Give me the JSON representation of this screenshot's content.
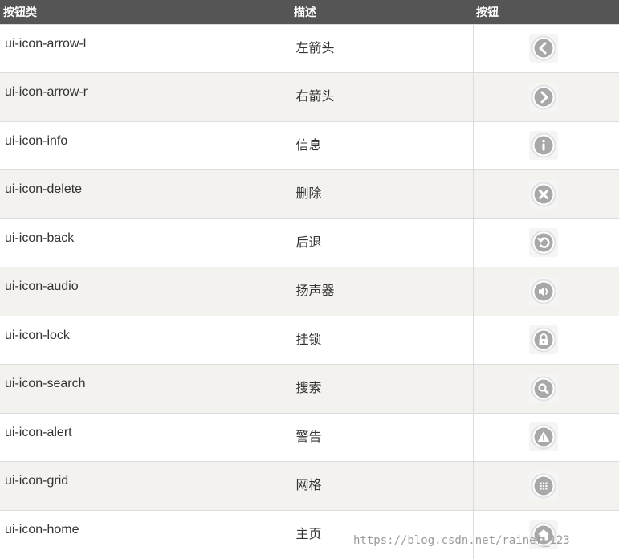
{
  "table": {
    "headers": [
      "按钮类",
      "描述",
      "按钮"
    ],
    "rows": [
      {
        "class_name": "ui-icon-arrow-l",
        "description": "左箭头",
        "icon": "arrow-left-icon"
      },
      {
        "class_name": "ui-icon-arrow-r",
        "description": "右箭头",
        "icon": "arrow-right-icon"
      },
      {
        "class_name": "ui-icon-info",
        "description": "信息",
        "icon": "info-icon"
      },
      {
        "class_name": "ui-icon-delete",
        "description": "删除",
        "icon": "delete-icon"
      },
      {
        "class_name": "ui-icon-back",
        "description": "后退",
        "icon": "back-icon"
      },
      {
        "class_name": "ui-icon-audio",
        "description": "扬声器",
        "icon": "audio-icon"
      },
      {
        "class_name": "ui-icon-lock",
        "description": "挂锁",
        "icon": "lock-icon"
      },
      {
        "class_name": "ui-icon-search",
        "description": "搜索",
        "icon": "search-icon"
      },
      {
        "class_name": "ui-icon-alert",
        "description": "警告",
        "icon": "alert-icon"
      },
      {
        "class_name": "ui-icon-grid",
        "description": "网格",
        "icon": "grid-icon"
      },
      {
        "class_name": "ui-icon-home",
        "description": "主页",
        "icon": "home-icon"
      }
    ]
  },
  "watermark": "https://blog.csdn.net/rainer_123",
  "colors": {
    "header_bg": "#555555",
    "header_text": "#ffffff",
    "alt_row_bg": "#f3f2ee",
    "icon_circle": "#a8a8a8",
    "icon_ring": "#e2e2e2"
  }
}
